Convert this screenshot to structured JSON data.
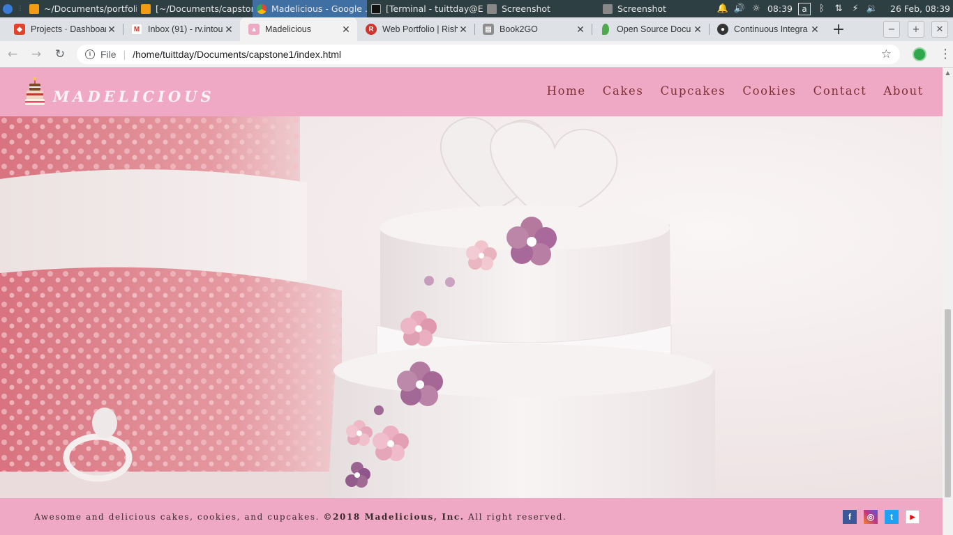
{
  "taskbar": {
    "tasks": [
      {
        "title": "~/Documents/portfolio...",
        "icon": "sublime-text-icon"
      },
      {
        "title": "[~/Documents/capston...",
        "icon": "sublime-text-icon"
      },
      {
        "title": "Madelicious - Google ...",
        "icon": "chrome-icon",
        "active": true
      },
      {
        "title": "[Terminal - tuittday@E...",
        "icon": "terminal-icon"
      },
      {
        "title": "Screenshot",
        "icon": "screenshot-icon"
      },
      {
        "title": "Screenshot",
        "icon": "screenshot-icon"
      }
    ],
    "clock": "08:39",
    "keyboard_layout": "a",
    "date_time": "26 Feb, 08:39"
  },
  "browser": {
    "tabs": [
      {
        "title": "Projects · Dashboard",
        "icon": "gitlab-icon",
        "color": "#e2432a"
      },
      {
        "title": "Inbox (91) - rv.intou",
        "icon": "gmail-icon",
        "color": "#d93025"
      },
      {
        "title": "Madelicious",
        "icon": "cake-favicon",
        "color": "#f0a9c4",
        "active": true
      },
      {
        "title": "Web Portfolio | Rish",
        "icon": "ruby-icon",
        "color": "#cc342d"
      },
      {
        "title": "Book2GO",
        "icon": "book-icon",
        "color": "#8d8d8d"
      },
      {
        "title": "Open Source Docu",
        "icon": "mongodb-leaf-icon",
        "color": "#4fa94d"
      },
      {
        "title": "Continuous Integra",
        "icon": "circleci-icon",
        "color": "#343434"
      }
    ],
    "address": {
      "scheme_label": "File",
      "url": "/home/tuittday/Documents/capstone1/index.html"
    }
  },
  "site": {
    "brand": "MADELICIOUS",
    "nav": [
      "Home",
      "Cakes",
      "Cupcakes",
      "Cookies",
      "Contact",
      "About"
    ],
    "footer": {
      "text_plain": "Awesome and delicious cakes, cookies, and cupcakes.",
      "text_bold": "©2018 Madelicious, Inc.",
      "text_tail": "All right reserved."
    },
    "social": [
      {
        "name": "facebook-icon",
        "glyph": "f",
        "color": "#3b5998"
      },
      {
        "name": "instagram-icon",
        "glyph": "◎",
        "color": "#c13584"
      },
      {
        "name": "twitter-icon",
        "glyph": "t",
        "color": "#1da1f2"
      },
      {
        "name": "youtube-icon",
        "glyph": "▶",
        "color": "#ff0000"
      }
    ],
    "colors": {
      "header_pink": "#f0a9c4",
      "nav_text": "#7d3136"
    }
  }
}
